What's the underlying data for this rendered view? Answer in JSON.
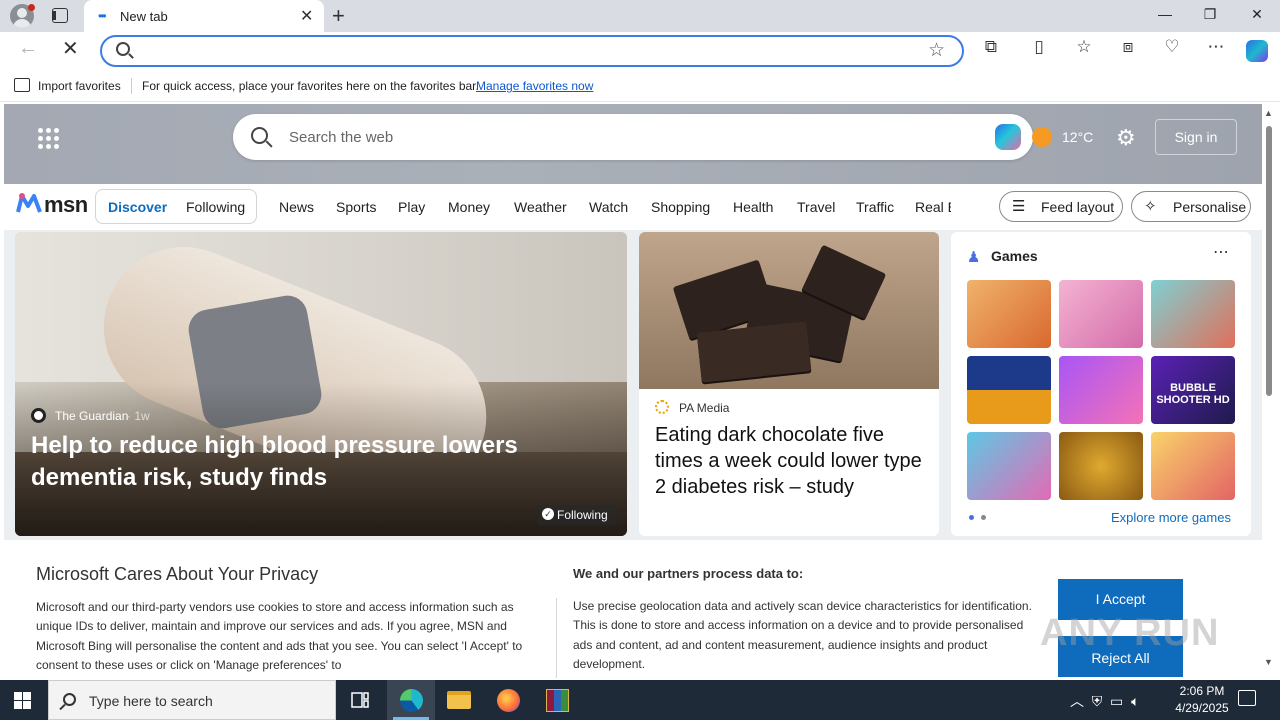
{
  "browser": {
    "tab_title": "New tab",
    "favorites_import": "Import favorites",
    "favorites_tip": "For quick access, place your favorites here on the favorites bar.",
    "favorites_link": "Manage favorites now"
  },
  "msn": {
    "search_placeholder": "Search the web",
    "temperature": "12°C",
    "sign_in": "Sign in",
    "logo_text": "msn",
    "segments": {
      "discover": "Discover",
      "following": "Following"
    },
    "nav": [
      "News",
      "Sports",
      "Play",
      "Money",
      "Weather",
      "Watch",
      "Shopping",
      "Health",
      "Travel",
      "Traffic",
      "Real E"
    ],
    "feed_layout": "Feed layout",
    "personalise": "Personalise"
  },
  "hero": {
    "source": "The Guardian",
    "age": "· 1w",
    "title": "Help to reduce high blood pressure lowers dementia risk, study finds",
    "following": "Following"
  },
  "card2": {
    "source": "PA Media",
    "title": "Eating dark chocolate five times a week could lower type 2 diabetes risk – study"
  },
  "games": {
    "title": "Games",
    "explore": "Explore more games",
    "bubble_text": "BUBBLE SHOOTER HD"
  },
  "privacy": {
    "title": "Microsoft Cares About Your Privacy",
    "body": "Microsoft and our third-party vendors use cookies to store and access information such as unique IDs to deliver, maintain and improve our services and ads. If you agree, MSN and Microsoft Bing will personalise the content and ads that you see. You can select 'I Accept' to consent to these uses or click on 'Manage preferences' to",
    "title2": "We and our partners process data to:",
    "body2": "Use precise geolocation data and actively scan device characteristics for identification. This is done to store and access information on a device and to provide personalised ads and content, ad and content measurement, audience insights and product development.",
    "accept": "I Accept",
    "reject": "Reject All"
  },
  "watermark": "ANY RUN",
  "taskbar": {
    "search_text": "Type here to search",
    "time": "2:06 PM",
    "date": "4/29/2025"
  },
  "colors": {
    "accent": "#0f6cbd",
    "taskbar": "#1f2a38",
    "address_border": "#3b7ce6"
  }
}
